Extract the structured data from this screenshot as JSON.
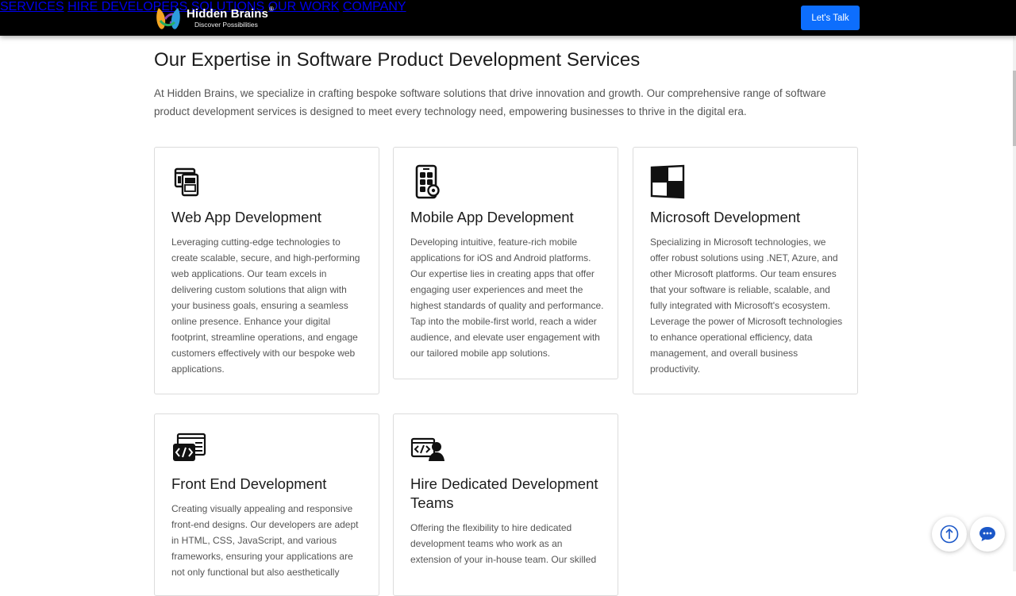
{
  "brand": {
    "name": "Hidden Brains",
    "registered": "®",
    "tagline": "Discover Possibilities"
  },
  "nav": {
    "items": [
      "SERVICES",
      "HIRE DEVELOPERS",
      "SOLUTIONS",
      "OUR WORK",
      "COMPANY"
    ],
    "cta_label": "Let's Talk"
  },
  "section": {
    "title": "Our Expertise in Software Product Development Services",
    "intro": "At Hidden Brains, we specialize in crafting bespoke software solutions that drive innovation and growth. Our comprehensive range of software product development services is designed to meet every technology need, empowering businesses to thrive in the digital era."
  },
  "cards": [
    {
      "icon": "web-app-icon",
      "title": "Web App Development",
      "body": "Leveraging cutting-edge technologies to create scalable, secure, and high-performing web applications. Our team excels in delivering custom solutions that align with your business goals, ensuring a seamless online presence. Enhance your digital footprint, streamline operations, and engage customers effectively with our bespoke web applications."
    },
    {
      "icon": "mobile-app-icon",
      "title": "Mobile App Development",
      "body": "Developing intuitive, feature-rich mobile applications for iOS and Android platforms. Our expertise lies in creating apps that offer engaging user experiences and meet the highest standards of quality and performance. Tap into the mobile-first world, reach a wider audience, and elevate user engagement with our tailored mobile app solutions."
    },
    {
      "icon": "windows-icon",
      "title": "Microsoft Development",
      "body": "Specializing in Microsoft technologies, we offer robust solutions using .NET, Azure, and other Microsoft platforms. Our team ensures that your software is reliable, scalable, and fully integrated with Microsoft's ecosystem. Leverage the power of Microsoft technologies to enhance operational efficiency, data management, and overall business productivity."
    },
    {
      "icon": "code-window-icon",
      "title": "Front End Development",
      "body": "Creating visually appealing and responsive front-end designs. Our developers are adept in HTML, CSS, JavaScript, and various frameworks, ensuring your applications are not only functional but also aesthetically"
    },
    {
      "icon": "developer-team-icon",
      "title": "Hire Dedicated Development Teams",
      "body": "Offering the flexibility to hire dedicated development teams who work as an extension of your in-house team. Our skilled"
    }
  ],
  "floating": {
    "scroll_top_icon": "arrow-up-icon",
    "chat_icon": "chat-icon"
  },
  "colors": {
    "header_bg": "#000000",
    "cta_bg": "#0d6efd",
    "fab_icon": "#1a57c8"
  }
}
